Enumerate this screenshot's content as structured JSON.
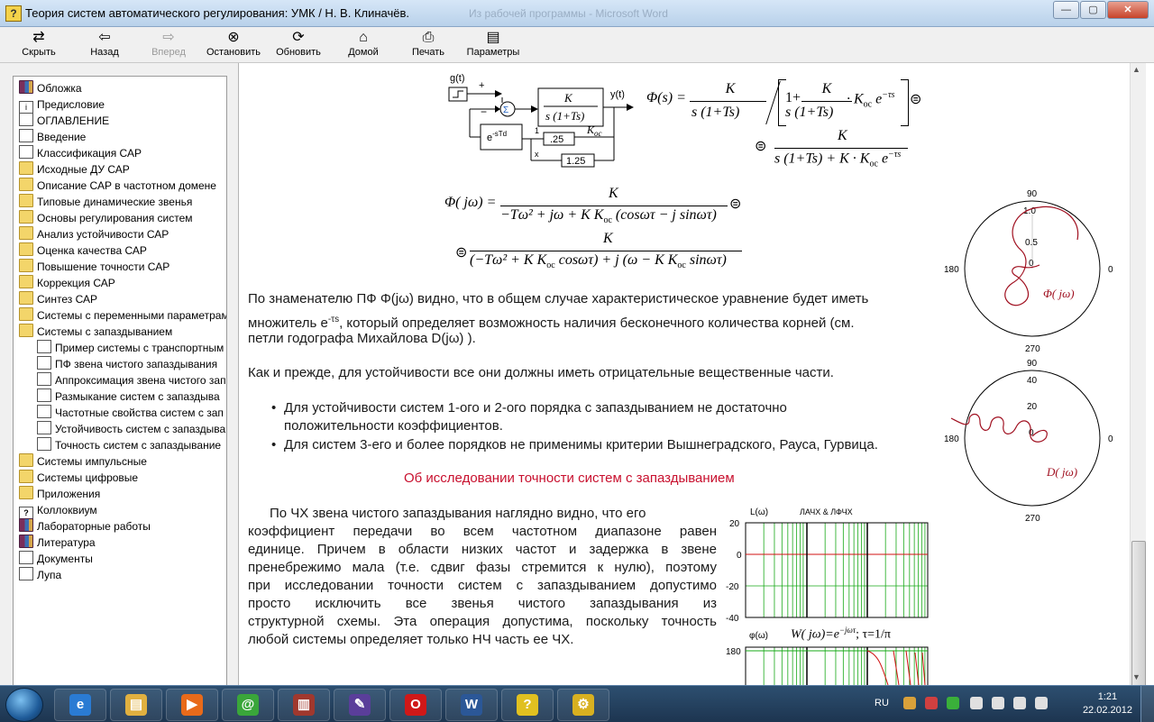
{
  "window": {
    "title": "Теория систем автоматического регулирования: УМК / Н. В. Клиначёв.",
    "background_title": "Из рабочей программы - Microsoft Word",
    "minimize": "—",
    "maximize": "▢",
    "close": "✕"
  },
  "toolbar": [
    {
      "label": "Скрыть",
      "icon": "hide-icon",
      "glyph": "⇄"
    },
    {
      "label": "Назад",
      "icon": "back-icon",
      "glyph": "⇦"
    },
    {
      "label": "Вперед",
      "icon": "forward-icon",
      "glyph": "⇨"
    },
    {
      "label": "Остановить",
      "icon": "stop-icon",
      "glyph": "⊗"
    },
    {
      "label": "Обновить",
      "icon": "refresh-icon",
      "glyph": "⟳"
    },
    {
      "label": "Домой",
      "icon": "home-icon",
      "glyph": "⌂"
    },
    {
      "label": "Печать",
      "icon": "print-icon",
      "glyph": "⎙"
    },
    {
      "label": "Параметры",
      "icon": "options-icon",
      "glyph": "▤"
    }
  ],
  "tree": [
    {
      "label": "Обложка",
      "icon": "book"
    },
    {
      "label": "Предисловие",
      "icon": "info"
    },
    {
      "label": "ОГЛАВЛЕНИЕ",
      "icon": "page"
    },
    {
      "label": "Введение",
      "icon": "page"
    },
    {
      "label": "Классификация САР",
      "icon": "page"
    },
    {
      "label": "Исходные ДУ САР",
      "icon": "folder"
    },
    {
      "label": "Описание САР в частотном домене",
      "icon": "folder"
    },
    {
      "label": "Типовые динамические звенья",
      "icon": "folder"
    },
    {
      "label": "Основы регулирования систем",
      "icon": "folder"
    },
    {
      "label": "Анализ устойчивости САР",
      "icon": "folder"
    },
    {
      "label": "Оценка качества САР",
      "icon": "folder"
    },
    {
      "label": "Повышение точности САР",
      "icon": "folder"
    },
    {
      "label": "Коррекция САР",
      "icon": "folder"
    },
    {
      "label": "Синтез САР",
      "icon": "folder"
    },
    {
      "label": "Системы с переменными параметрами",
      "icon": "folder"
    },
    {
      "label": "Системы с запаздыванием",
      "icon": "folder-open"
    },
    {
      "label": "Пример системы с транспортным",
      "icon": "page",
      "indent": 1
    },
    {
      "label": "ПФ звена чистого запаздывания",
      "icon": "page",
      "indent": 1
    },
    {
      "label": "Аппроксимация звена чистого зап",
      "icon": "page",
      "indent": 1
    },
    {
      "label": "Размыкание систем с запаздыва",
      "icon": "page",
      "indent": 1
    },
    {
      "label": "Частотные свойства систем с зап",
      "icon": "page",
      "indent": 1
    },
    {
      "label": "Устойчивость систем с запаздыва",
      "icon": "page",
      "indent": 1
    },
    {
      "label": "Точность систем с запаздывание",
      "icon": "page",
      "indent": 1
    },
    {
      "label": "Системы импульсные",
      "icon": "folder"
    },
    {
      "label": "Системы цифровые",
      "icon": "folder"
    },
    {
      "label": "Приложения",
      "icon": "folder"
    },
    {
      "label": "Коллоквиум",
      "icon": "qpage"
    },
    {
      "label": "Лабораторные работы",
      "icon": "book"
    },
    {
      "label": "Литература",
      "icon": "book"
    },
    {
      "label": "Документы",
      "icon": "page"
    },
    {
      "label": "Лупа",
      "icon": "page"
    }
  ],
  "diagram": {
    "input": "g(t)",
    "output": "y(t)",
    "plus": "+",
    "minus": "−",
    "sum": "Σ",
    "tf_num": "K",
    "tf_den": "s (1+Ts)",
    "delay": "e",
    "delay_exp": "-sTd",
    "gain1": ".25",
    "gain2": "1.25",
    "koc": "K",
    "koc_sub": "oc",
    "one": "1",
    "x": "x"
  },
  "formulas": {
    "phi_s": "Φ(s) =",
    "f1_num": "K",
    "f1_den": "s (1+Ts)",
    "f1_bracket_num": "K",
    "f1_bracket_den": "s (1+Ts)",
    "f1_tail": "· K",
    "f1_exp": "−τs",
    "f2_num": "K",
    "f2_den": "s (1+Ts) + K · K",
    "f3_lhs": "Φ( jω) =",
    "f3_num": "K",
    "f3_den": "−Tω² + jω + K K",
    "f3_den_tail": "(cosωτ − j sinωτ)",
    "f4_num": "K",
    "f4_den": "(−Tω² + K K",
    "f4_den_tail": "cosωτ) + j (ω − K K",
    "f4_den_end": "sinωτ)"
  },
  "paragraphs": {
    "p1_a": "По знаменателю ПФ Φ(jω) видно, что в общем случае характеристическое уравнение будет иметь",
    "p1_b": "множитель e",
    "p1_b_exp": "-τs",
    "p1_b_tail": ", который определяет возможность наличия бесконечного количества корней (см.",
    "p1_c": "петли годографа Михайлова D(jω) ).",
    "p2": "Как и прежде, для устойчивости все они должны иметь отрицательные вещественные части.",
    "bullet1_a": "Для устойчивости систем 1-ого и 2-ого порядка с запаздыванием не достаточно",
    "bullet1_b": "положительности коэффициентов.",
    "bullet2": "Для систем 3-его и более порядков не применимы критерии Вышнеградского, Рауса, Гурвица.",
    "heading": "Об исследовании точности систем с запаздыванием",
    "p3_1": "По ЧХ звена чистого запаздывания наглядно видно, что его",
    "p3_2": "коэффициент передачи во всем частотном диапазоне равен",
    "p3_3": "единице. Причем в области низких частот и задержка в звене",
    "p3_4": "пренебрежимо мала (т.е. сдвиг фазы стремится к нулю), поэтому",
    "p3_5": "при исследовании точности систем с запаздыванием допустимо",
    "p3_6": "просто исключить все звенья чистого запаздывания из",
    "p3_7": "структурной схемы. Эта операция допустима, поскольку точность",
    "p3_8": "любой системы определяет только НЧ часть ее ЧХ."
  },
  "polar1": {
    "top": "90",
    "bottom": "270",
    "left": "180",
    "right": "0",
    "r1": "1.0",
    "r2": "0.5",
    "r0": "0",
    "label": "Φ( jω)"
  },
  "polar2": {
    "top": "90",
    "bottom": "270",
    "left": "180",
    "right": "0",
    "r1": "40",
    "r2": "20",
    "r0": "0",
    "label": "D( jω)"
  },
  "bode": {
    "title": "ЛАЧХ & ЛФЧХ",
    "ylabel_mag": "L(ω)",
    "ylabel_phase": "φ(ω)",
    "mag_ticks": [
      "20",
      "0",
      "-20",
      "-40"
    ],
    "phase_tick": "180",
    "formula": "W( jω)=e",
    "formula_exp": "−jωτ",
    "formula_tail": ";  τ=1/π",
    "grid_color": "#17a817",
    "line_color": "#d01010"
  },
  "taskbar": {
    "lang": "RU",
    "time": "1:21",
    "date": "22.02.2012",
    "apps": [
      {
        "name": "ie",
        "glyph": "e",
        "color": "#2a7bd3"
      },
      {
        "name": "explorer",
        "glyph": "▤",
        "color": "#e0b040"
      },
      {
        "name": "media",
        "glyph": "▶",
        "color": "#e86a1a"
      },
      {
        "name": "mail",
        "glyph": "@",
        "color": "#3aa63a"
      },
      {
        "name": "winrar",
        "glyph": "▥",
        "color": "#a0382e"
      },
      {
        "name": "editor",
        "glyph": "✎",
        "color": "#5a3e9a"
      },
      {
        "name": "opera",
        "glyph": "O",
        "color": "#d01818"
      },
      {
        "name": "word",
        "glyph": "W",
        "color": "#2b5797"
      },
      {
        "name": "help",
        "glyph": "?",
        "color": "#e0c020"
      },
      {
        "name": "tool",
        "glyph": "⚙",
        "color": "#d8b020"
      }
    ]
  },
  "colors": {
    "accent": "#c8102e",
    "plot": "#a01020"
  }
}
